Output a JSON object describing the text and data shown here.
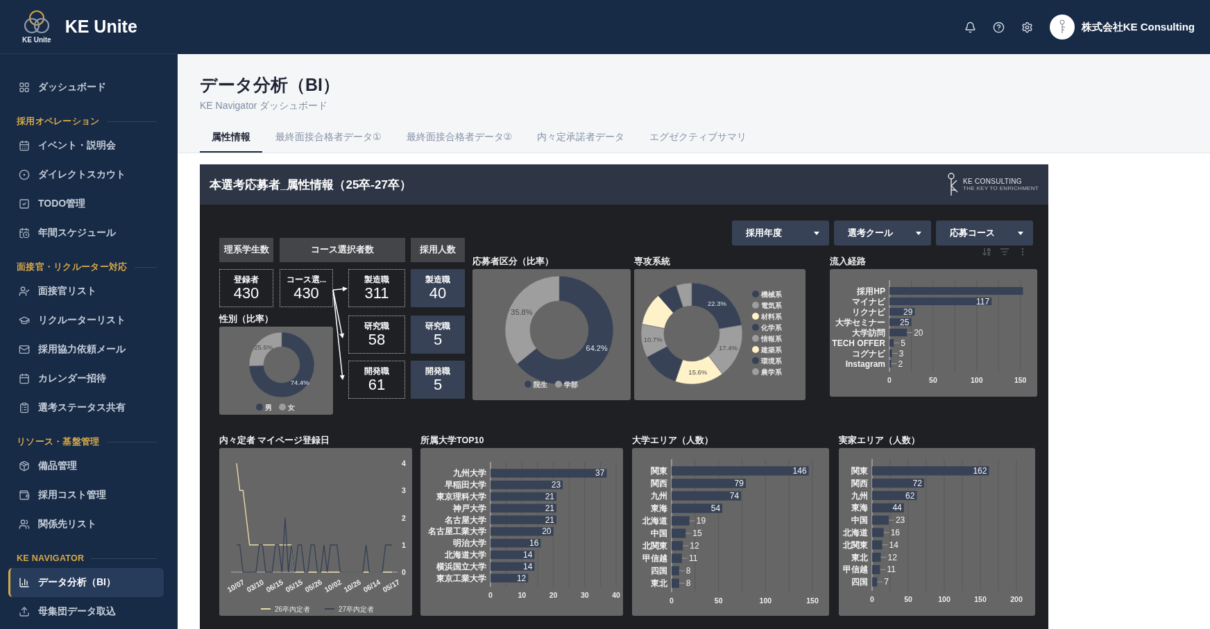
{
  "app": {
    "logo_caption": "KE Unite",
    "name": "KE Unite"
  },
  "header": {
    "company": "株式会社KE Consulting"
  },
  "sidebar": {
    "groups": [
      {
        "items": [
          {
            "label": "ダッシュボード",
            "selected": false
          }
        ]
      },
      {
        "heading": "採用オペレーション",
        "items": [
          {
            "label": "イベント・説明会",
            "selected": false
          },
          {
            "label": "ダイレクトスカウト",
            "selected": false
          },
          {
            "label": "TODO管理",
            "selected": false
          },
          {
            "label": "年間スケジュール",
            "selected": false
          }
        ]
      },
      {
        "heading": "面接官・リクルーター対応",
        "items": [
          {
            "label": "面接官リスト",
            "selected": false
          },
          {
            "label": "リクルーターリスト",
            "selected": false
          },
          {
            "label": "採用協力依頼メール",
            "selected": false
          },
          {
            "label": "カレンダー招待",
            "selected": false
          },
          {
            "label": "選考ステータス共有",
            "selected": false
          }
        ]
      },
      {
        "heading": "リソース・基盤管理",
        "items": [
          {
            "label": "備品管理",
            "selected": false
          },
          {
            "label": "採用コスト管理",
            "selected": false
          },
          {
            "label": "関係先リスト",
            "selected": false
          }
        ]
      },
      {
        "heading": "KE NAVIGATOR",
        "items": [
          {
            "label": "データ分析（BI）",
            "selected": true
          },
          {
            "label": "母集団データ取込",
            "selected": false
          }
        ]
      }
    ]
  },
  "page": {
    "title": "データ分析（BI）",
    "subtitle": "KE Navigator ダッシュボード"
  },
  "tabs": [
    {
      "label": "属性情報",
      "selected": true
    },
    {
      "label": "最終面接合格者データ①",
      "selected": false
    },
    {
      "label": "最終面接合格者データ②",
      "selected": false
    },
    {
      "label": "内々定承諾者データ",
      "selected": false
    },
    {
      "label": "エグゼクティブサマリ",
      "selected": false
    }
  ],
  "report": {
    "title": "本選考応募者_属性情報（25卒-27卒）",
    "brand": "KE CONSULTING",
    "brand_tagline": "THE KEY TO ENRICHMENT",
    "filters": [
      "採用年度",
      "選考クール",
      "応募コース"
    ],
    "kpi_headers": [
      "理系学生数",
      "コース選択者数",
      "採用人数"
    ],
    "registered": {
      "label": "登録者",
      "value": "430"
    },
    "course_selected": {
      "label": "コース選...",
      "value": "430"
    },
    "courses": [
      {
        "label": "製造職",
        "value": "311"
      },
      {
        "label": "研究職",
        "value": "58"
      },
      {
        "label": "開発職",
        "value": "61"
      }
    ],
    "hires": [
      {
        "label": "製造職",
        "value": "40"
      },
      {
        "label": "研究職",
        "value": "5"
      },
      {
        "label": "開発職",
        "value": "5"
      }
    ],
    "gender": {
      "chart_data": {
        "type": "donut",
        "title": "性別（比率）",
        "categories": [
          "男",
          "女"
        ],
        "values": [
          74.4,
          25.6
        ],
        "legend": "bottom",
        "colors": [
          "#374256",
          "#9e9e9e"
        ],
        "value_labels": [
          "74.4%",
          "25.6%"
        ]
      }
    },
    "applicant_type": {
      "chart_data": {
        "type": "donut",
        "title": "応募者区分（比率）",
        "categories": [
          "院生",
          "学部"
        ],
        "values": [
          64.2,
          35.8
        ],
        "legend": "bottom",
        "colors": [
          "#374256",
          "#9e9e9e"
        ],
        "value_labels": [
          "64.2%",
          "35.8%"
        ]
      }
    },
    "major": {
      "chart_data": {
        "type": "donut",
        "title": "専攻系統",
        "categories": [
          "機械系",
          "電気系",
          "材料系",
          "化学系",
          "情報系",
          "建築系",
          "環境系",
          "農学系"
        ],
        "values": [
          22.3,
          17.4,
          15.6,
          12.0,
          10.7,
          10.5,
          6.5,
          5.0
        ],
        "legend": "right",
        "colors": [
          "#374256",
          "#9e9e9e",
          "#fff1c8",
          "#374256",
          "#9e9e9e",
          "#fff1c8",
          "#374256",
          "#9e9e9e"
        ],
        "value_labels": [
          "22.3%",
          "17.4%",
          "15.6%",
          null,
          "10.7%",
          null,
          null,
          null
        ]
      }
    },
    "inflow": {
      "chart_data": {
        "type": "bar",
        "orientation": "horizontal",
        "title": "流入経路",
        "categories": [
          "採用HP",
          "マイナビ",
          "リクナビ",
          "大学セミナー",
          "大学訪問",
          "TECH OFFER",
          "コグナビ",
          "Instagram"
        ],
        "values": [
          153,
          117,
          29,
          25,
          20,
          5,
          3,
          2
        ],
        "value_labels": [
          null,
          "117",
          "29",
          "25",
          "20",
          "5",
          "3",
          "2"
        ],
        "xlim": [
          0,
          155
        ],
        "xticks": [
          0,
          50,
          100,
          150
        ],
        "grid": true
      }
    },
    "mypage": {
      "chart_data": {
        "type": "line",
        "title": "内々定者 マイページ登録日",
        "categories": [
          "10/07",
          null,
          null,
          null,
          null,
          null,
          "03/10",
          null,
          null,
          null,
          null,
          null,
          "06/15",
          null,
          null,
          null,
          null,
          null,
          "05/15",
          null,
          null,
          null,
          null,
          null,
          "05/26",
          null,
          null,
          null,
          null,
          null,
          "10/02",
          null,
          null,
          null,
          null,
          null,
          "10/26",
          null,
          null,
          null,
          null,
          null,
          "06/14",
          null,
          null,
          null,
          null,
          null,
          "05/17"
        ],
        "ylim": [
          0,
          4
        ],
        "yticks": [
          0,
          1,
          2,
          3,
          4
        ],
        "legend": "bottom",
        "series": [
          {
            "name": "26卒内定者",
            "color": "#e9dba8",
            "values": [
              4,
              3,
              3,
              2,
              1,
              1,
              1,
              1,
              1,
              1,
              1,
              1,
              1,
              1,
              1,
              1,
              1,
              1,
              0,
              0,
              0,
              0,
              0,
              0,
              0,
              0,
              0,
              0,
              0,
              0,
              0,
              0,
              0,
              0,
              0,
              0,
              0,
              0,
              0,
              0,
              0,
              0,
              0,
              0,
              0,
              0,
              0,
              0,
              0
            ]
          },
          {
            "name": "27卒内定者",
            "color": "#374256",
            "values": [
              1,
              1,
              0,
              0,
              0,
              0,
              0,
              1,
              1,
              0,
              0,
              0,
              1,
              1,
              0,
              2,
              0,
              1,
              0,
              1,
              1,
              0,
              0,
              1,
              1,
              0,
              0,
              1,
              0,
              1,
              1,
              1,
              0,
              0,
              0,
              0,
              0,
              0,
              0,
              0,
              1,
              0,
              0,
              0,
              0,
              0,
              1,
              1,
              1
            ]
          }
        ]
      }
    },
    "university": {
      "chart_data": {
        "type": "bar",
        "orientation": "horizontal",
        "title": "所属大学TOP10",
        "categories": [
          "九州大学",
          "早稲田大学",
          "東京理科大学",
          "神戸大学",
          "名古屋大学",
          "名古屋工業大学",
          "明治大学",
          "北海道大学",
          "横浜国立大学",
          "東京工業大学"
        ],
        "values": [
          37,
          23,
          21,
          21,
          21,
          20,
          16,
          14,
          14,
          12
        ],
        "value_labels": [
          "37",
          "23",
          "21",
          "21",
          "21",
          "20",
          "16",
          "14",
          "14",
          "12"
        ],
        "xlim": [
          0,
          40
        ],
        "xticks": [
          0,
          10,
          20,
          30,
          40
        ],
        "grid": true
      }
    },
    "university_area": {
      "chart_data": {
        "type": "bar",
        "orientation": "horizontal",
        "title": "大学エリア（人数）",
        "categories": [
          "関東",
          "関西",
          "九州",
          "東海",
          "北海道",
          "中国",
          "北関東",
          "甲信越",
          "四国",
          "東北"
        ],
        "values": [
          146,
          79,
          74,
          54,
          19,
          15,
          12,
          11,
          8,
          8
        ],
        "value_labels": [
          "146",
          "79",
          "74",
          "54",
          "19",
          "15",
          "12",
          "11",
          "8",
          "8"
        ],
        "xlim": [
          0,
          150
        ],
        "xticks": [
          0,
          50,
          100,
          150
        ],
        "grid": true
      }
    },
    "home_area": {
      "chart_data": {
        "type": "bar",
        "orientation": "horizontal",
        "title": "実家エリア（人数）",
        "categories": [
          "関東",
          "関西",
          "九州",
          "東海",
          "中国",
          "北海道",
          "北関東",
          "東北",
          "甲信越",
          "四国"
        ],
        "values": [
          162,
          72,
          62,
          44,
          23,
          16,
          14,
          12,
          11,
          7
        ],
        "value_labels": [
          "162",
          "72",
          "62",
          "44",
          "23",
          "16",
          "14",
          "12",
          "11",
          "7"
        ],
        "xlim": [
          0,
          200
        ],
        "xticks": [
          0,
          50,
          100,
          150,
          200
        ],
        "grid": true
      }
    }
  }
}
